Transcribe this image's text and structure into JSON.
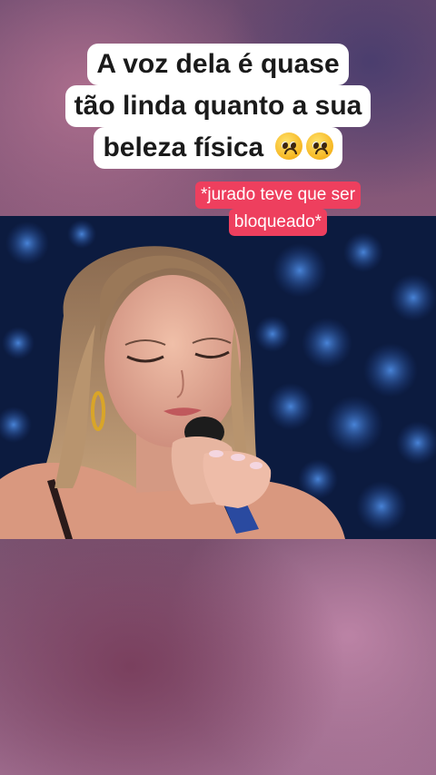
{
  "caption": {
    "lines": [
      "A voz dela é quase",
      "tão linda quanto a sua",
      "beleza física"
    ],
    "emoji": "pleading-face-icon"
  },
  "note": {
    "lines": [
      "*jurado teve que ser",
      "bloqueado*"
    ]
  },
  "colors": {
    "caption_bg": "#ffffff",
    "caption_text": "#1a1a1a",
    "note_bg": "#ee3f5e",
    "stage_bg": "#0b1a3a"
  }
}
